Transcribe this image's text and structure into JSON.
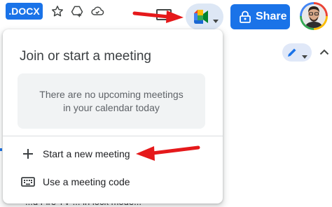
{
  "header": {
    "file_badge": ".DOCX",
    "icons": [
      "star-icon",
      "move-to-drive-icon",
      "cloud-saved-icon",
      "present-icon"
    ],
    "meet_button": {
      "icon": "google-meet-icon"
    },
    "share_button": {
      "label": "Share",
      "icon": "lock-people-icon"
    }
  },
  "toolbar": {
    "mode_icon": "pencil-icon",
    "collapse_icon": "chevron-up-icon"
  },
  "meet_popup": {
    "title": "Join or start a meeting",
    "empty_state": {
      "line1": "There are no upcoming meetings",
      "line2": "in your calendar today"
    },
    "items": [
      {
        "label": "Start a new meeting",
        "icon": "plus-icon"
      },
      {
        "label": "Use a meeting code",
        "icon": "keyboard-icon"
      }
    ]
  },
  "document": {
    "partial_text": "...d Fire TV ... in lock mode..."
  },
  "colors": {
    "accent": "#1a73e8",
    "annotation_arrow": "#e5191b",
    "empty_state_bg": "#f1f3f4",
    "meet_button_bg": "#dde7f5"
  }
}
